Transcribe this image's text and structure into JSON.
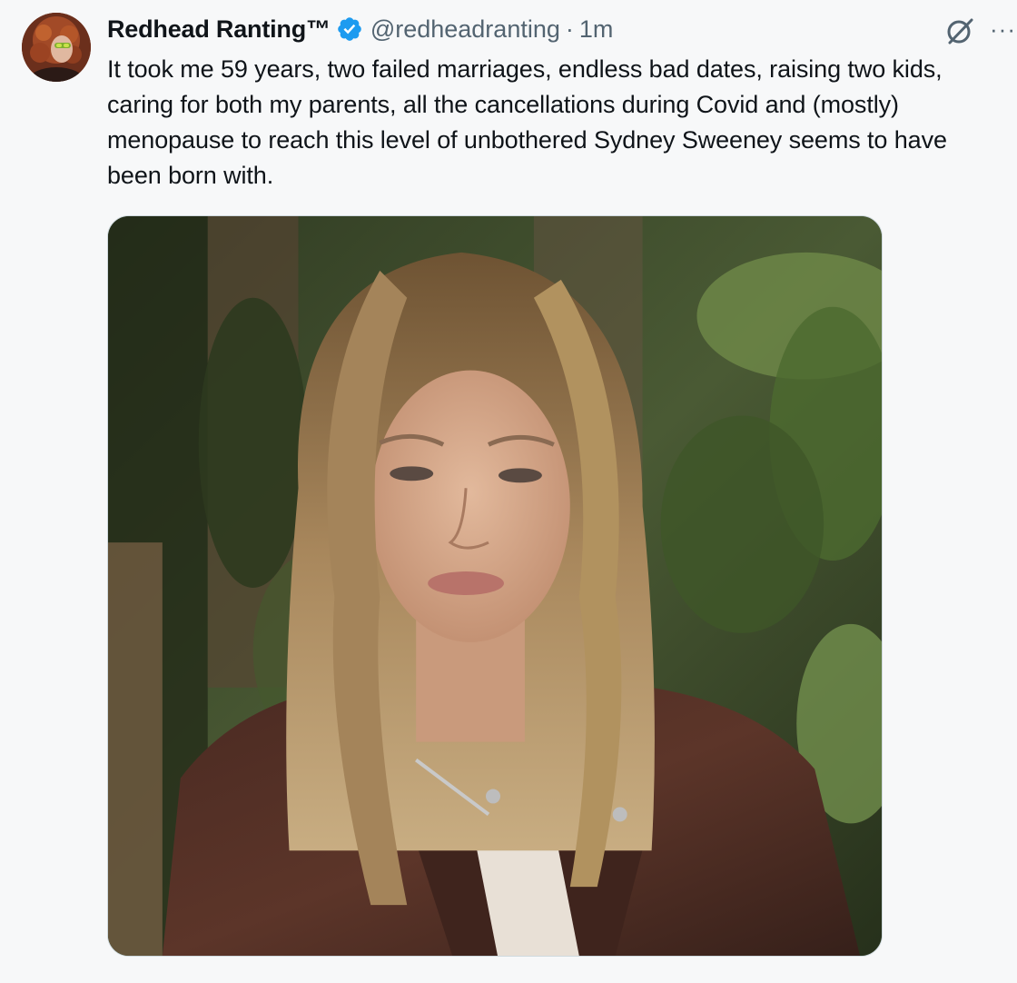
{
  "tweet": {
    "author": {
      "display_name": "Redhead Ranting™",
      "verified": true,
      "handle": "@redheadranting",
      "separator": "·",
      "time": "1m"
    },
    "text": "It took me 59 years, two failed marriages, endless bad dates, raising two kids, caring for both my parents, all the cancellations during Covid and (mostly) menopause to reach this level of unbothered Sydney Sweeney seems to have been born with.",
    "actions": {
      "grok_icon": "grok-icon",
      "more_icon": "more-icon",
      "more_label": "···"
    }
  },
  "colors": {
    "background": "#f7f8f9",
    "text": "#0f1419",
    "secondary_text": "#536471",
    "verified_blue": "#1d9bf0"
  }
}
